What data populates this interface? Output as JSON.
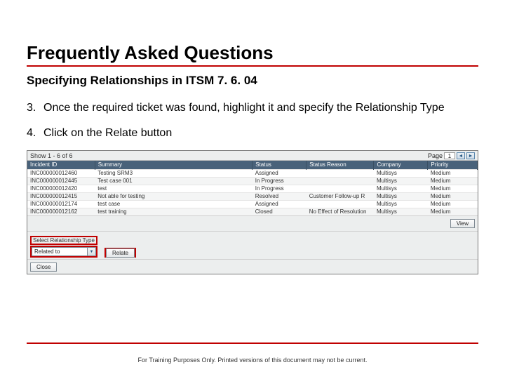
{
  "title": "Frequently Asked Questions",
  "subtitle": "Specifying Relationships in ITSM 7. 6. 04",
  "steps": [
    {
      "num": "3.",
      "text": "Once the required ticket was found, highlight it and specify the Relationship Type"
    },
    {
      "num": "4.",
      "text": "Click on the Relate button"
    }
  ],
  "screenshot": {
    "toolbar_left": "Show 1 - 6 of 6",
    "page_label": "Page",
    "page_value": "1",
    "headers": [
      "Incident ID",
      "Summary",
      "Status",
      "Status Reason",
      "Company",
      "Priority"
    ],
    "col_widths": [
      "15%",
      "35%",
      "12%",
      "15%",
      "12%",
      "11%"
    ],
    "rows": [
      [
        "INC000000012460",
        "Testing SRM3",
        "Assigned",
        "",
        "Multisys",
        "Medium"
      ],
      [
        "INC000000012445",
        "Test case 001",
        "In Progress",
        "",
        "Multisys",
        "Medium"
      ],
      [
        "INC000000012420",
        "test",
        "In Progress",
        "",
        "Multisys",
        "Medium"
      ],
      [
        "INC000000012415",
        "Not able for testing",
        "Resolved",
        "Customer Follow-up R",
        "Multisys",
        "Medium"
      ],
      [
        "INC000000012174",
        "test case",
        "Assigned",
        "",
        "Multisys",
        "Medium"
      ],
      [
        "INC000000012162",
        "test training",
        "Closed",
        "No Effect of Resolution",
        "Multisys",
        "Medium"
      ]
    ],
    "view_label": "View",
    "reltype_caption": "Select Relationship Type",
    "reltype_value": "Related to",
    "relate_label": "Relate",
    "close_label": "Close"
  },
  "footer": "For Training Purposes Only. Printed versions of this document may not be current."
}
